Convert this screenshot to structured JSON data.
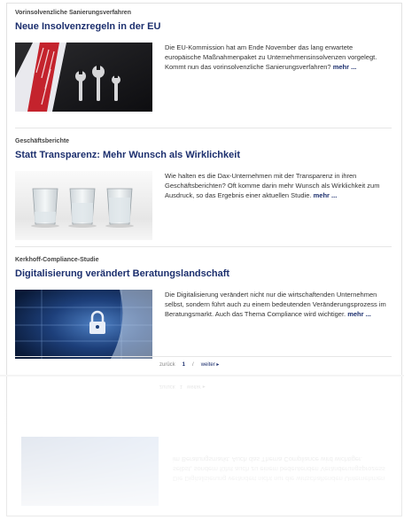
{
  "articles": [
    {
      "kicker": "Vorinsolvenzliche Sanierungsverfahren",
      "title": "Neue Insolvenzregeln in der EU",
      "teaser": "Die EU-Kommission hat am Ende November das lang erwartete europäische Maßnahmenpaket zu Unternehmensinsolvenzen vorgelegt. Kommt nun das vorinsolvenzliche Sanierungsverfahren?",
      "more": "mehr ...",
      "image": "suit-tie-wrenches"
    },
    {
      "kicker": "Geschäftsberichte",
      "title": "Statt Transparenz: Mehr Wunsch als Wirklichkeit",
      "teaser": "Wie halten es die Dax-Unternehmen mit der Transparenz in ihren Geschäftsberichten? Oft komme darin mehr Wunsch als Wirklichkeit zum Ausdruck, so das Ergebnis einer aktuellen Studie.",
      "more": "mehr ...",
      "image": "water-glasses"
    },
    {
      "kicker": "Kerkhoff-Compliance-Studie",
      "title": "Digitalisierung verändert Beratungslandschaft",
      "teaser": "Die Digitalisierung verändert nicht nur die wirtschaftenden Unternehmen selbst, sondern führt auch zu einem bedeutenden Veränderungsprozess im Beratungsmarkt. Auch das Thema Compliance wird wichtiger.",
      "more": "mehr ...",
      "image": "digital-lock"
    }
  ],
  "pagination": {
    "prev": "zurück",
    "current": "1",
    "separator": "/",
    "next": "weiter ▸"
  },
  "colors": {
    "headline": "#1c2f6e",
    "divider": "#e6e6e6"
  }
}
